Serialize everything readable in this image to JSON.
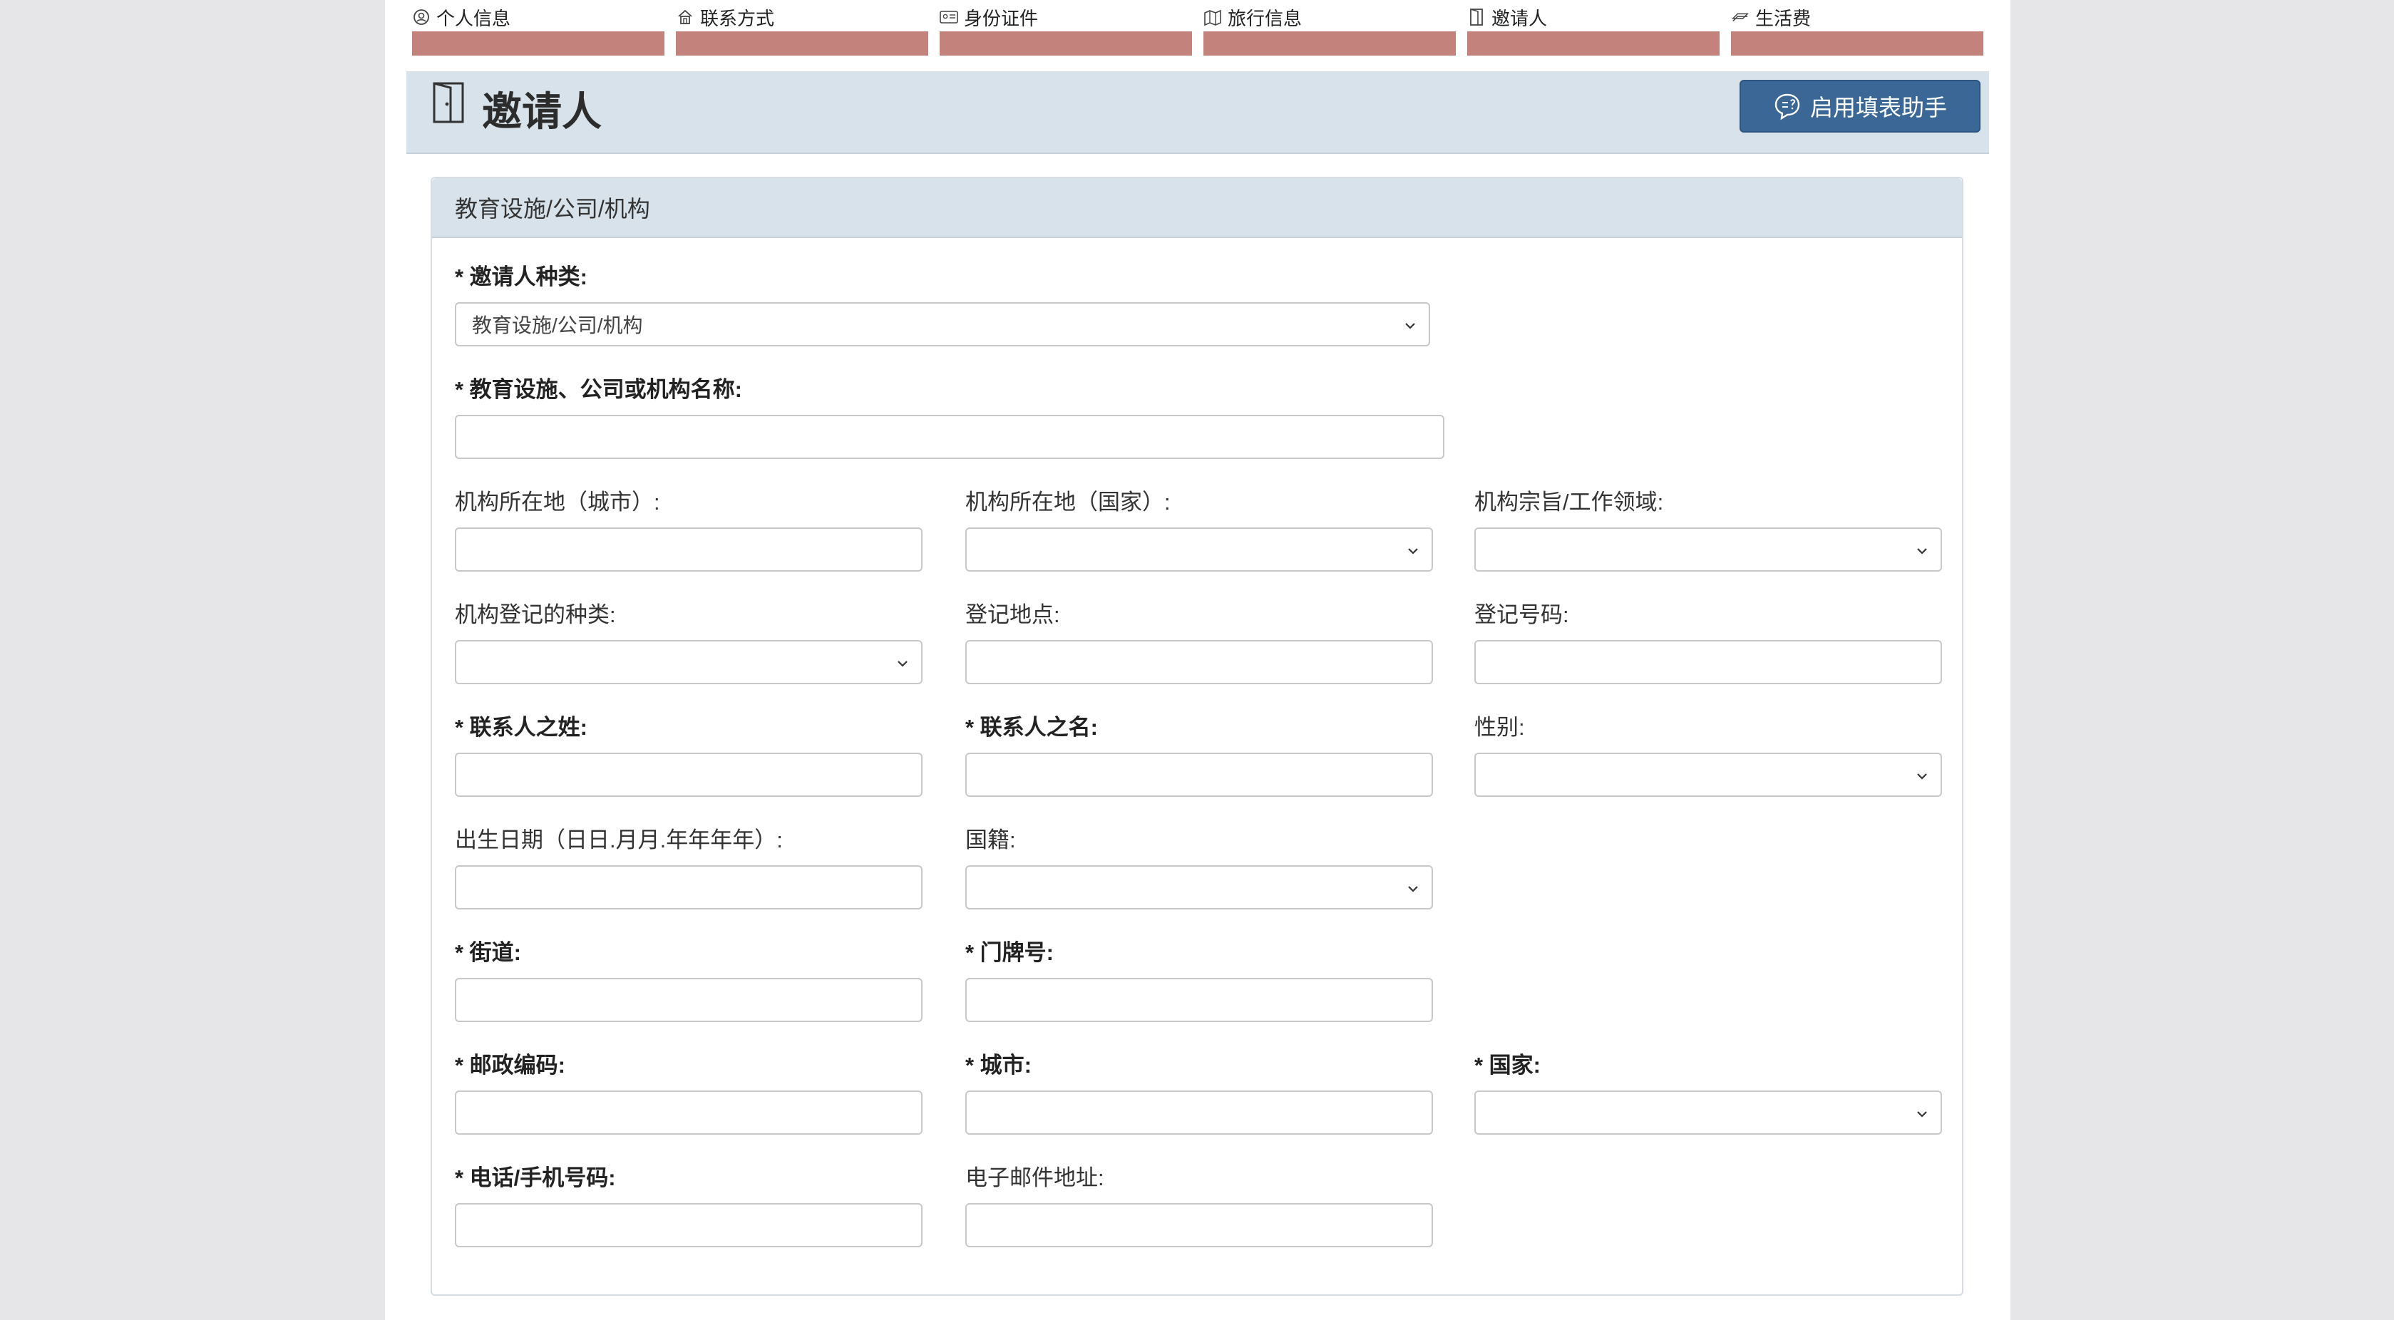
{
  "steps": [
    {
      "label": "个人信息",
      "icon": "person-circle-icon"
    },
    {
      "label": "联系方式",
      "icon": "house-icon"
    },
    {
      "label": "身份证件",
      "icon": "id-card-icon"
    },
    {
      "label": "旅行信息",
      "icon": "map-icon"
    },
    {
      "label": "邀请人",
      "icon": "door-icon"
    },
    {
      "label": "生活费",
      "icon": "money-icon"
    }
  ],
  "header": {
    "title": "邀请人",
    "assist_button": "启用填表助手"
  },
  "panel": {
    "title": "教育设施/公司/机构"
  },
  "form": {
    "inviter_type": {
      "label": "* 邀请人种类:",
      "value": "教育设施/公司/机构"
    },
    "org_name": {
      "label": "* 教育设施、公司或机构名称:",
      "value": ""
    },
    "org_city": {
      "label": "机构所在地（城市）:",
      "value": ""
    },
    "org_country": {
      "label": "机构所在地（国家）:",
      "value": ""
    },
    "org_purpose": {
      "label": "机构宗旨/工作领域:",
      "value": ""
    },
    "reg_type": {
      "label": "机构登记的种类:",
      "value": ""
    },
    "reg_place": {
      "label": "登记地点:",
      "value": ""
    },
    "reg_number": {
      "label": "登记号码:",
      "value": ""
    },
    "contact_surname": {
      "label": "* 联系人之姓:",
      "value": ""
    },
    "contact_given": {
      "label": "* 联系人之名:",
      "value": ""
    },
    "gender": {
      "label": "性别:",
      "value": ""
    },
    "birthdate": {
      "label": "出生日期（日日.月月.年年年年）:",
      "value": ""
    },
    "nationality": {
      "label": "国籍:",
      "value": ""
    },
    "street": {
      "label": "* 街道:",
      "value": ""
    },
    "house_no": {
      "label": "* 门牌号:",
      "value": ""
    },
    "postcode": {
      "label": "* 邮政编码:",
      "value": ""
    },
    "city": {
      "label": "* 城市:",
      "value": ""
    },
    "country": {
      "label": "* 国家:",
      "value": ""
    },
    "phone": {
      "label": "* 电话/手机号码:",
      "value": ""
    },
    "email": {
      "label": "电子邮件地址:",
      "value": ""
    }
  },
  "colors": {
    "step_bar": "#c4827d",
    "header_band": "#d7e2ea",
    "primary_button": "#3a6796"
  }
}
